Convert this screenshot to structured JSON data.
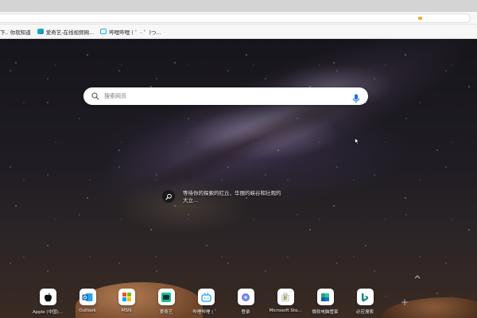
{
  "bookmarks": [
    {
      "label": "下.. 你就知道",
      "icon": "none"
    },
    {
      "label": "爱奇艺-在线视频网...",
      "icon": "video-icon"
    },
    {
      "label": "哔哩哔哩 ( ゜- ゜)つ...",
      "icon": "bilibili-icon"
    }
  ],
  "search": {
    "placeholder": "搜索网页"
  },
  "caption": {
    "text": "等待你的探索的红丘、华丽的峡谷和壮观的大立..."
  },
  "quick_links": [
    {
      "label": "Apple (中国)...",
      "icon": "apple-icon"
    },
    {
      "label": "Outlook",
      "icon": "outlook-icon"
    },
    {
      "label": "MSN",
      "icon": "msn-icon"
    },
    {
      "label": "爱奇艺",
      "icon": "iqiyi-icon"
    },
    {
      "label": "哔哩哔哩 ( ゜",
      "icon": "bilibili-icon"
    },
    {
      "label": "登录",
      "icon": "copilot-icon"
    },
    {
      "label": "Microsoft Sto...",
      "icon": "store-icon"
    },
    {
      "label": "微软电脑管家",
      "icon": "pc-manager-icon"
    },
    {
      "label": "必应搜索",
      "icon": "bing-icon"
    }
  ],
  "colors": {
    "bing_teal": "#0f8b7d",
    "outlook_blue": "#0a64c8"
  }
}
